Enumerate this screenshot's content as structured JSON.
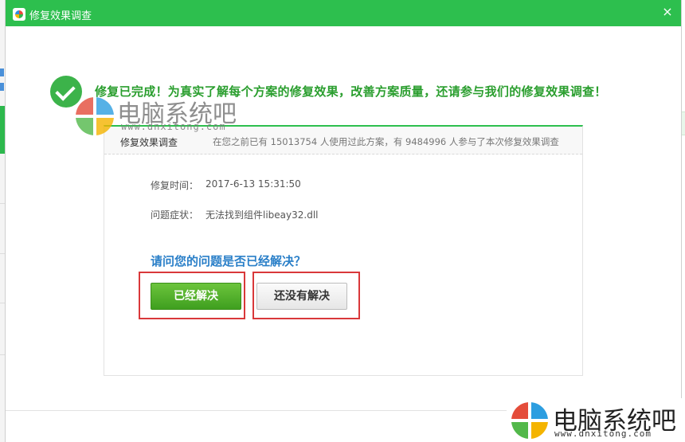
{
  "dialog": {
    "title": "修复效果调查",
    "close_label": "×",
    "headline": "修复已完成！为真实了解每个方案的修复效果，改善方案质量，还请参与我们的修复效果调查！"
  },
  "watermark": {
    "name": "电脑系统吧",
    "url": "www.dnxitong.com"
  },
  "panel": {
    "title": "修复效果调查",
    "stats": "在您之前已有 15013754 人使用过此方案，有 9484996 人参与了本次修复效果调查",
    "fields": [
      {
        "label": "修复时间：",
        "value": "2017-6-13 15:31:50"
      },
      {
        "label": "问题症状：",
        "value": "无法找到组件libeay32.dll"
      }
    ],
    "question": "请问您的问题是否已经解决？",
    "buttons": {
      "solved": "已经解决",
      "unsolved": "还没有解决"
    }
  },
  "colors": {
    "titlebar": "#2dbf4e",
    "headline": "#2a9e2e",
    "question": "#2a7fc8",
    "highlight": "#d9383a"
  },
  "icons": [
    "app-icon",
    "close-icon",
    "success-check-icon",
    "watermark-logo-icon"
  ]
}
